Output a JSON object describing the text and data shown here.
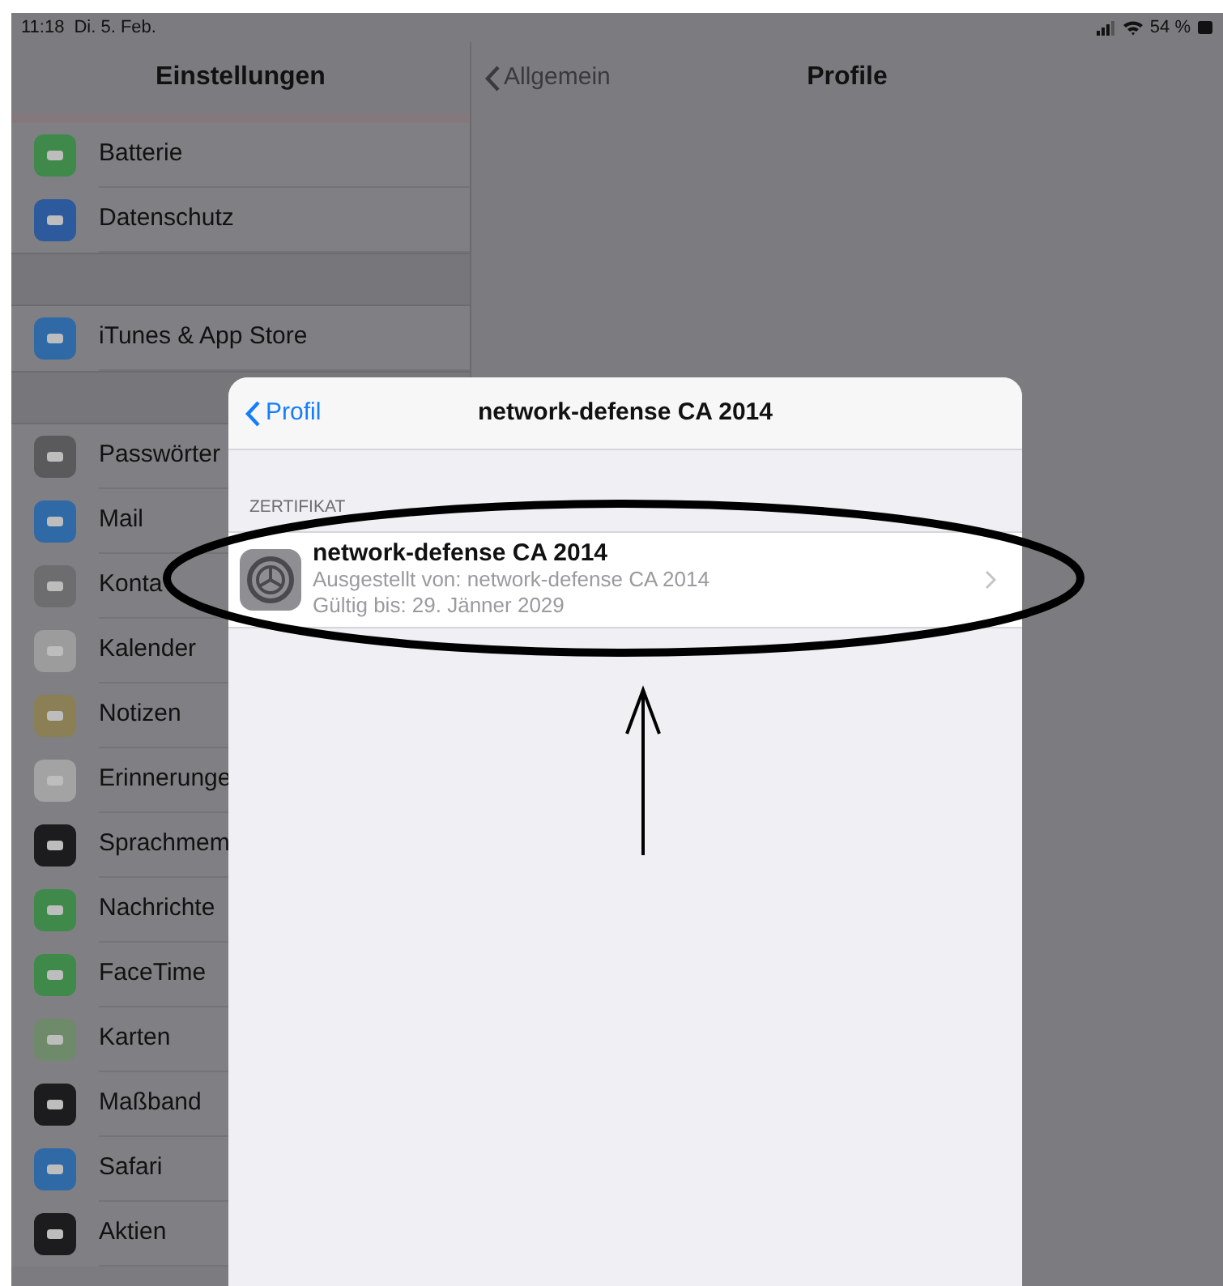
{
  "status_bar": {
    "time": "11:18",
    "date": "Di. 5. Feb.",
    "battery": "54 %"
  },
  "sidebar": {
    "title": "Einstellungen",
    "groups": [
      [
        {
          "label": "Batterie",
          "color": "#3f8a4a"
        },
        {
          "label": "Datenschutz",
          "color": "#2c5a9c"
        }
      ],
      [
        {
          "label": "iTunes & App Store",
          "color": "#2f6aa6"
        }
      ],
      [
        {
          "label": "Passwörter",
          "color": "#5a5a5c"
        },
        {
          "label": "Mail",
          "color": "#2f6aa6"
        },
        {
          "label": "Konta",
          "color": "#6d6d6f"
        },
        {
          "label": "Kalender",
          "color": "#9c9c9c"
        },
        {
          "label": "Notizen",
          "color": "#8a7f55"
        },
        {
          "label": "Erinnerunge",
          "color": "#a3a3a3"
        },
        {
          "label": "Sprachmem",
          "color": "#1c1c1f"
        },
        {
          "label": "Nachrichte",
          "color": "#3f8a4a"
        },
        {
          "label": "FaceTime",
          "color": "#3f8a4a"
        },
        {
          "label": "Karten",
          "color": "#6f8a6a"
        },
        {
          "label": "Maßband",
          "color": "#1c1c1e"
        },
        {
          "label": "Safari",
          "color": "#2f6aa6"
        },
        {
          "label": "Aktien",
          "color": "#1c1c1e"
        }
      ]
    ]
  },
  "detail": {
    "back": "Allgemein",
    "title": "Profile"
  },
  "sheet": {
    "back": "Profil",
    "title": "network-defense CA 2014",
    "section": "ZERTIFIKAT",
    "certificate": {
      "name": "network-defense CA 2014",
      "issuer": "Ausgestellt von: network-defense CA 2014",
      "expires": "Gültig bis: 29. Jänner 2029"
    }
  }
}
